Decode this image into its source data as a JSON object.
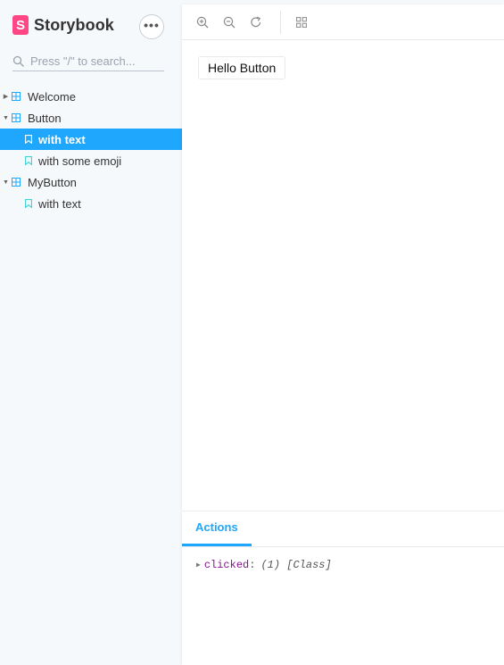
{
  "brand": {
    "logo_letter": "S",
    "name": "Storybook",
    "accent": "#ff4785"
  },
  "menu": {
    "label": "•••"
  },
  "search": {
    "placeholder": "Press \"/\" to search..."
  },
  "tree": {
    "items": [
      {
        "label": "Welcome"
      },
      {
        "label": "Button"
      },
      {
        "label": "with text"
      },
      {
        "label": "with some emoji"
      },
      {
        "label": "MyButton"
      },
      {
        "label": "with text"
      }
    ]
  },
  "preview": {
    "button_label": "Hello Button"
  },
  "panel": {
    "tab_label": "Actions",
    "log": {
      "name": "clicked",
      "colon": ":",
      "value": "(1) [Class]"
    }
  },
  "colors": {
    "selected": "#1ea7fd",
    "icon": "#1ea7fd",
    "sidebar_bg": "#f6f9fc"
  }
}
